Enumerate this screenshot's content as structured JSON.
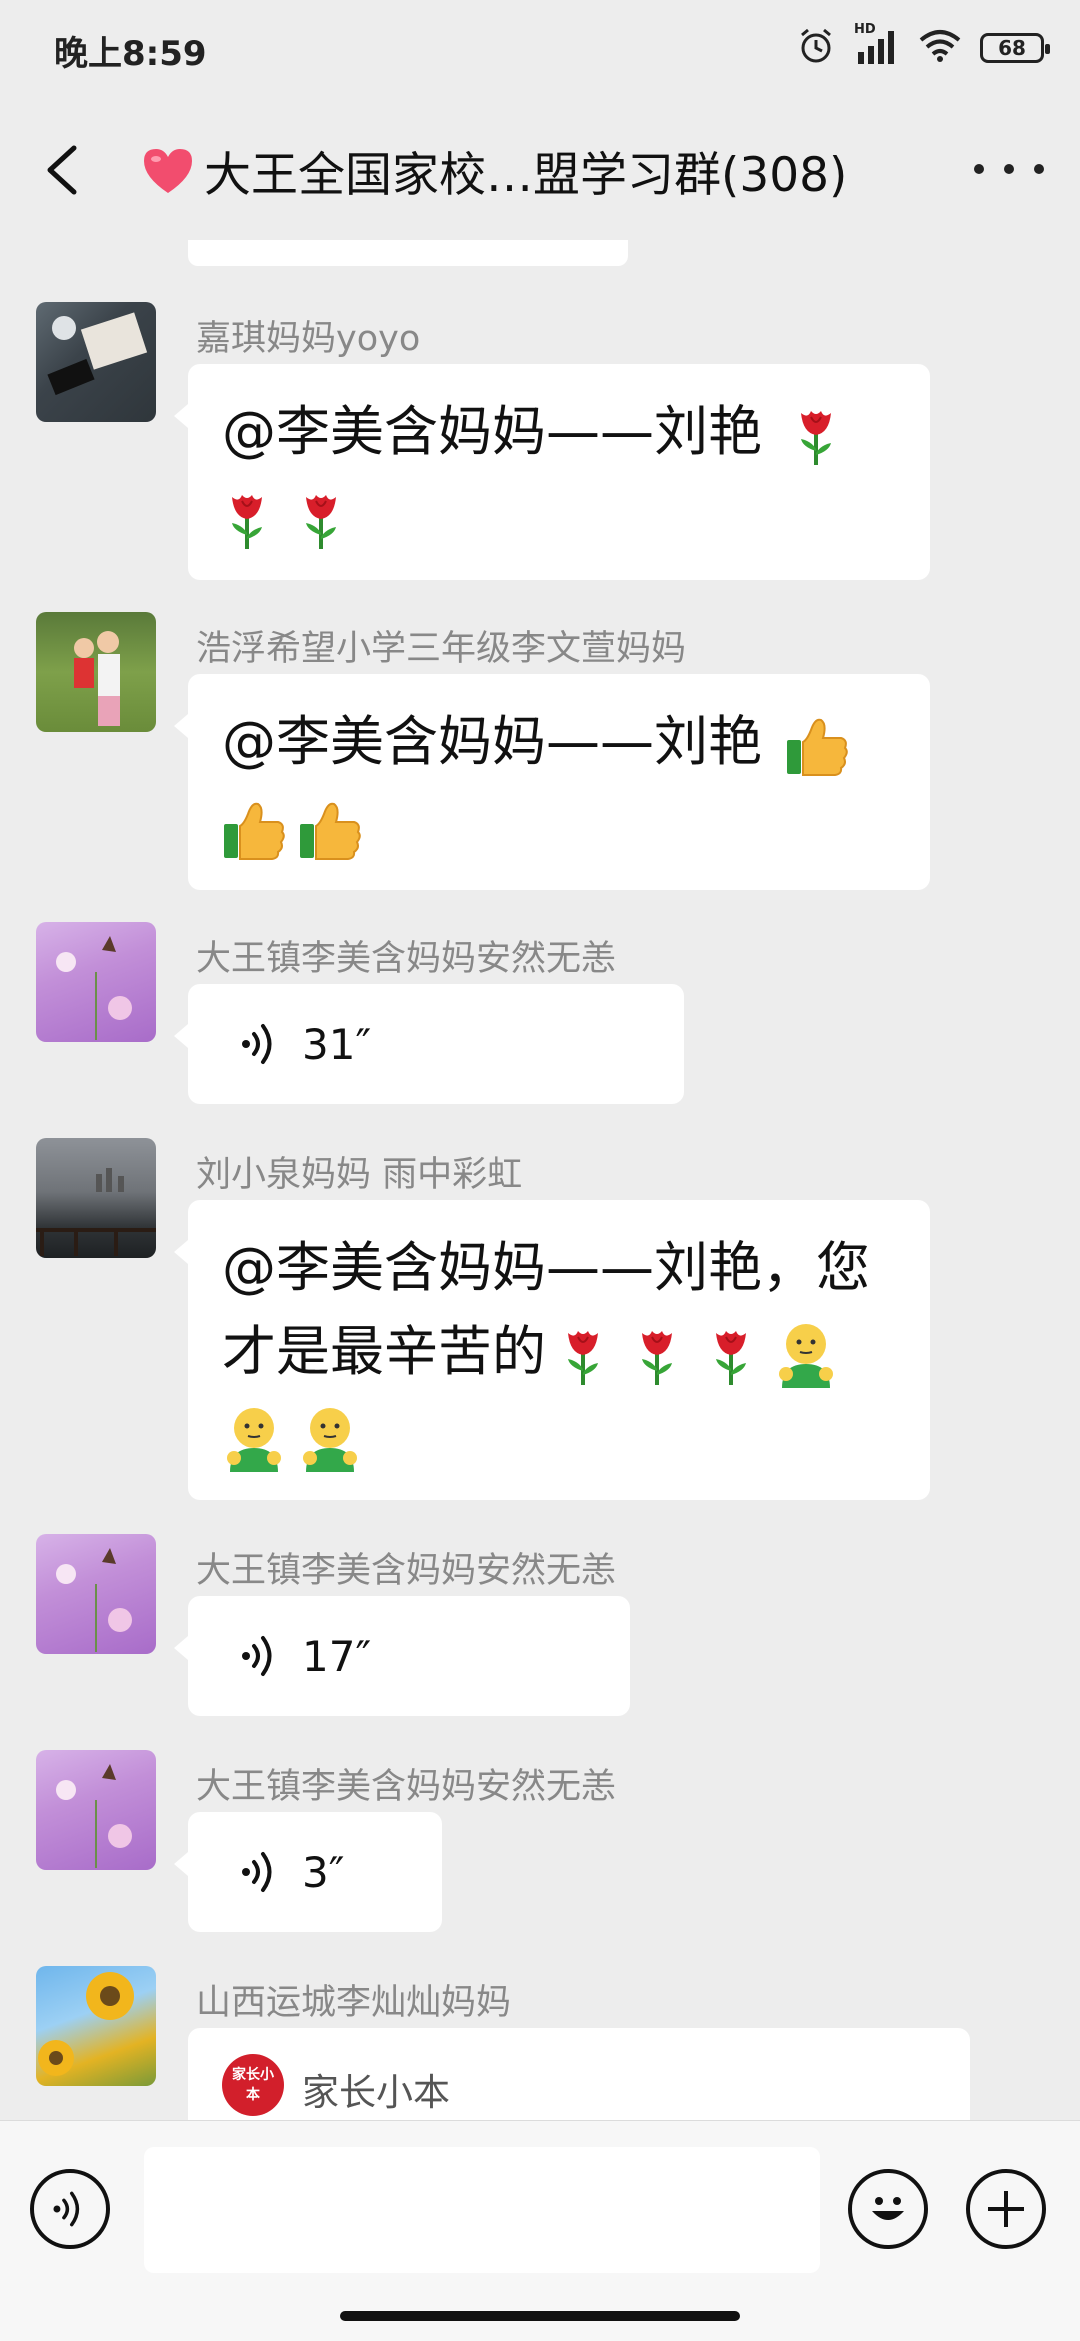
{
  "status_bar": {
    "time": "晚上8:59",
    "hd_label": "HD",
    "battery": "68",
    "icons": [
      "alarm-icon",
      "signal-icon",
      "wifi-icon",
      "battery-icon"
    ]
  },
  "header": {
    "title": "大王全国家校…盟学习群(308)",
    "icons": [
      "back-arrow-icon",
      "heart-emoji-icon",
      "more-icon"
    ]
  },
  "messages": [
    {
      "sender": "嘉琪妈妈yoyo",
      "type": "text",
      "line1": "@李美含妈妈——刘艳",
      "emoji": [
        "rose",
        "rose",
        "rose"
      ]
    },
    {
      "sender": "浩浮希望小学三年级李文萱妈妈",
      "type": "text",
      "line1": "@李美含妈妈——刘艳",
      "emoji": [
        "thumbs-up",
        "thumbs-up",
        "thumbs-up"
      ]
    },
    {
      "sender": "大王镇李美含妈妈安然无恙",
      "type": "voice",
      "duration": "31″"
    },
    {
      "sender": "刘小泉妈妈  雨中彩虹",
      "type": "text",
      "line1": "@李美含妈妈——刘艳，您",
      "line2": "才是最辛苦的",
      "emoji": [
        "rose",
        "rose",
        "rose",
        "hug",
        "hug",
        "hug"
      ]
    },
    {
      "sender": "大王镇李美含妈妈安然无恙",
      "type": "voice",
      "duration": "17″"
    },
    {
      "sender": "大王镇李美含妈妈安然无恙",
      "type": "voice",
      "duration": "3″"
    },
    {
      "sender": "山西运城李灿灿妈妈",
      "type": "mini-program",
      "card_logo": "家长小本",
      "card_name": "家长小本"
    }
  ],
  "input_bar": {
    "placeholder": "",
    "icons": [
      "voice-input-icon",
      "emoji-icon",
      "plus-icon"
    ]
  }
}
